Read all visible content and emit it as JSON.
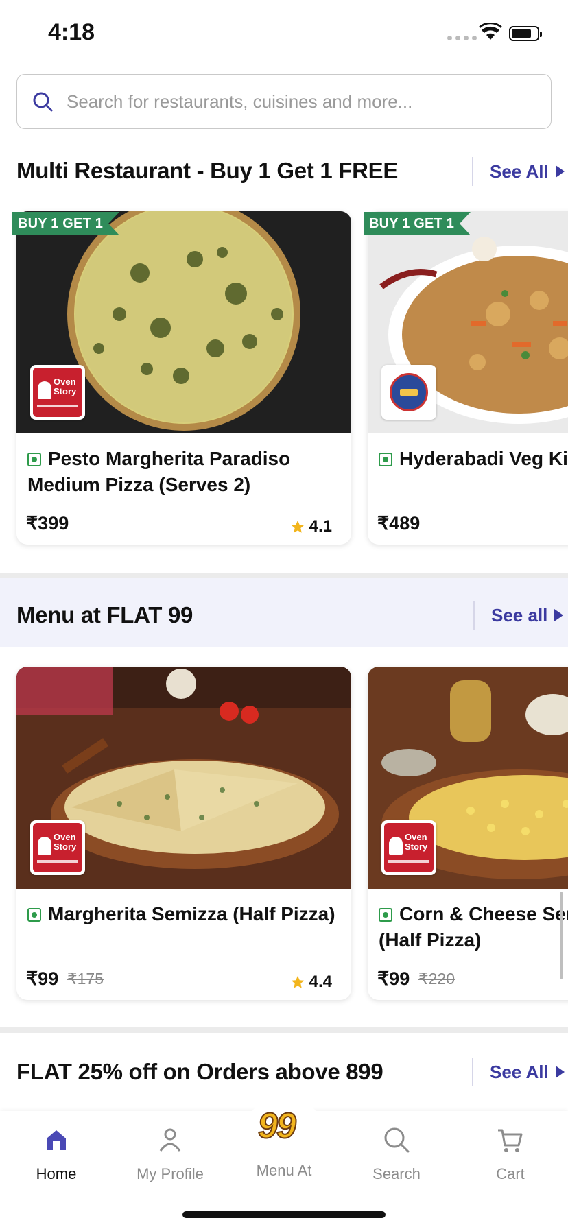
{
  "status": {
    "time": "4:18"
  },
  "search": {
    "placeholder": "Search for restaurants, cuisines and more..."
  },
  "section1": {
    "title": "Multi Restaurant - Buy 1 Get 1 FREE",
    "see_all": "See All",
    "cards": [
      {
        "badge": "BUY 1 GET 1",
        "name_line1": "Pesto Margherita Paradiso",
        "name_line2": "Medium Pizza (Serves 2)",
        "price": "₹399",
        "rating": "4.1",
        "restaurant_logo": "Oven Story"
      },
      {
        "badge": "BUY 1 GET 1",
        "name_line1": "Hyderabadi Veg Kil",
        "price": "₹489",
        "restaurant_logo": "The Biryani Life"
      }
    ]
  },
  "section2": {
    "title": "Menu at FLAT 99",
    "see_all": "See all",
    "cards": [
      {
        "name_line1": "Margherita Semizza (Half Pizza)",
        "price": "₹99",
        "mrp": "₹175",
        "rating": "4.4",
        "restaurant_logo": "Oven Story"
      },
      {
        "name_line1": "Corn & Cheese Sem",
        "name_line2": "(Half Pizza)",
        "price": "₹99",
        "mrp": "₹220",
        "restaurant_logo": "Oven Story"
      }
    ]
  },
  "section3": {
    "title": "FLAT 25% off on Orders above 899",
    "see_all": "See All"
  },
  "logos": {
    "oven_story": "Oven Story"
  },
  "bottom_nav": {
    "items": [
      {
        "label": "Home",
        "icon": "home-icon",
        "active": true
      },
      {
        "label": "My Profile",
        "icon": "profile-icon"
      },
      {
        "label": "Menu At",
        "icon": "menu-99-icon",
        "badge": "99"
      },
      {
        "label": "Search",
        "icon": "search-icon"
      },
      {
        "label": "Cart",
        "icon": "cart-icon"
      }
    ]
  },
  "colors": {
    "accent": "#3b3aa0",
    "veg": "#2e9b4b",
    "ribbon": "#2f8c5a",
    "star": "#f2b51d"
  }
}
